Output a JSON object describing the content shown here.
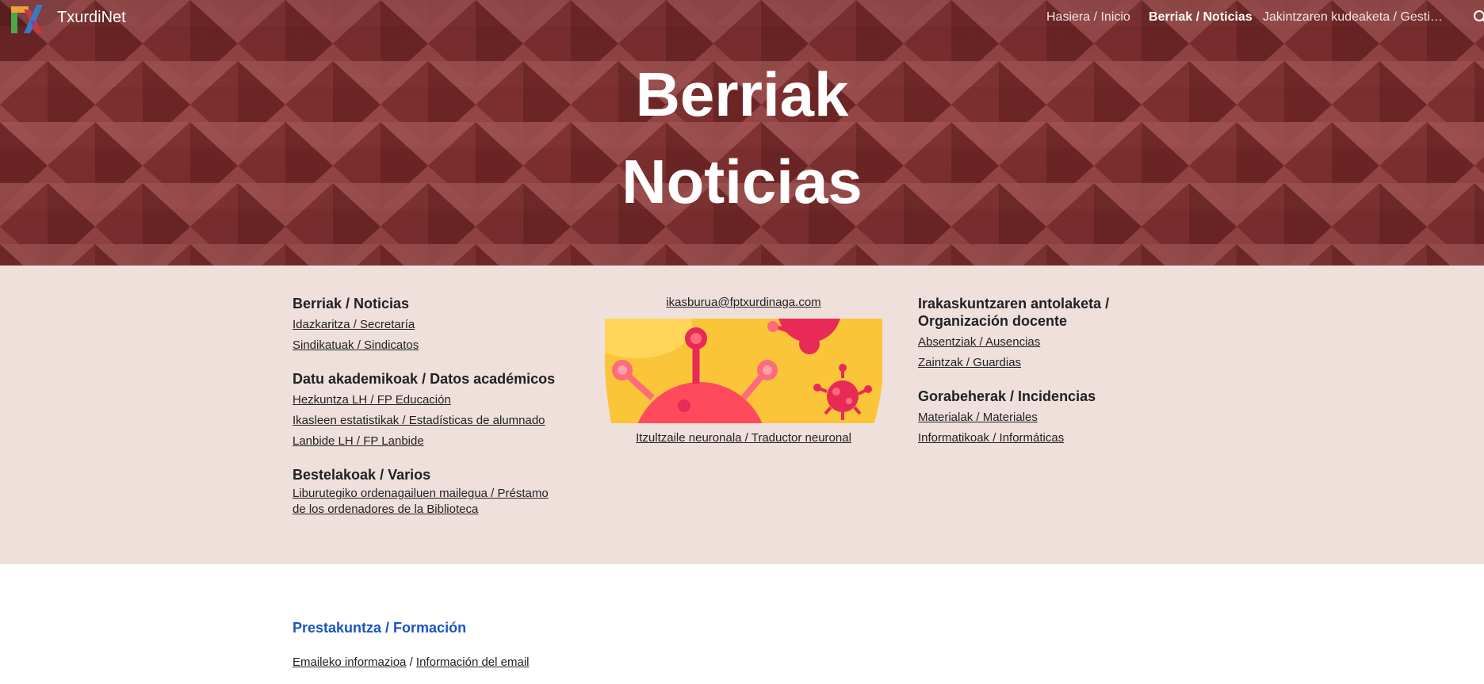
{
  "site": {
    "name": "TxurdiNet",
    "logo_icon": "txurdinet-logo-icon"
  },
  "nav": {
    "items": [
      {
        "label": "Hasiera / Inicio",
        "active": false
      },
      {
        "label": "Berriak / Noticias",
        "active": true
      },
      {
        "label": "Jakintzaren kudeaketa / Gestión ...",
        "active": false
      }
    ],
    "search_icon": "search-icon"
  },
  "hero": {
    "title_line1": "Berriak",
    "title_line2": "Noticias",
    "background_color": "#7a2d2d"
  },
  "left_column": {
    "groups": [
      {
        "title": "Berriak / Noticias",
        "links": [
          "Idazkaritza / Secretaría",
          "Sindikatuak / Sindicatos"
        ]
      },
      {
        "title": "Datu akademikoak / Datos académicos",
        "links": [
          "Hezkuntza LH / FP Educación",
          "Ikasleen estatistikak / Estadísticas de alumnado",
          "Lanbide LH / FP Lanbide"
        ]
      },
      {
        "title": "Bestelakoak / Varios",
        "links": [
          "Liburutegiko ordenagailuen mailegua / Préstamo de los ordenadores de la Biblioteca"
        ]
      }
    ]
  },
  "middle_column": {
    "email": "ikasburua@fptxurdinaga.com",
    "banner_caption": "Itzultzaile neuronala / Traductor neuronal"
  },
  "right_column": {
    "groups": [
      {
        "title": "Irakaskuntzaren antolaketa / Organización docente",
        "links": [
          "Absentziak / Ausencias",
          "Zaintzak / Guardias"
        ]
      },
      {
        "title": "Gorabeherak / Incidencias",
        "links": [
          "Materialak / Materiales",
          "Informatikoak / Informáticas"
        ]
      }
    ]
  },
  "training": {
    "title": "Prestakuntza / Formación",
    "email_info_eu": "Emaileko informazioa",
    "separator": "/",
    "email_info_es": "Información del email"
  },
  "colors": {
    "pink_bg": "#f0e0dc",
    "accent_blue": "#1a55c0"
  }
}
